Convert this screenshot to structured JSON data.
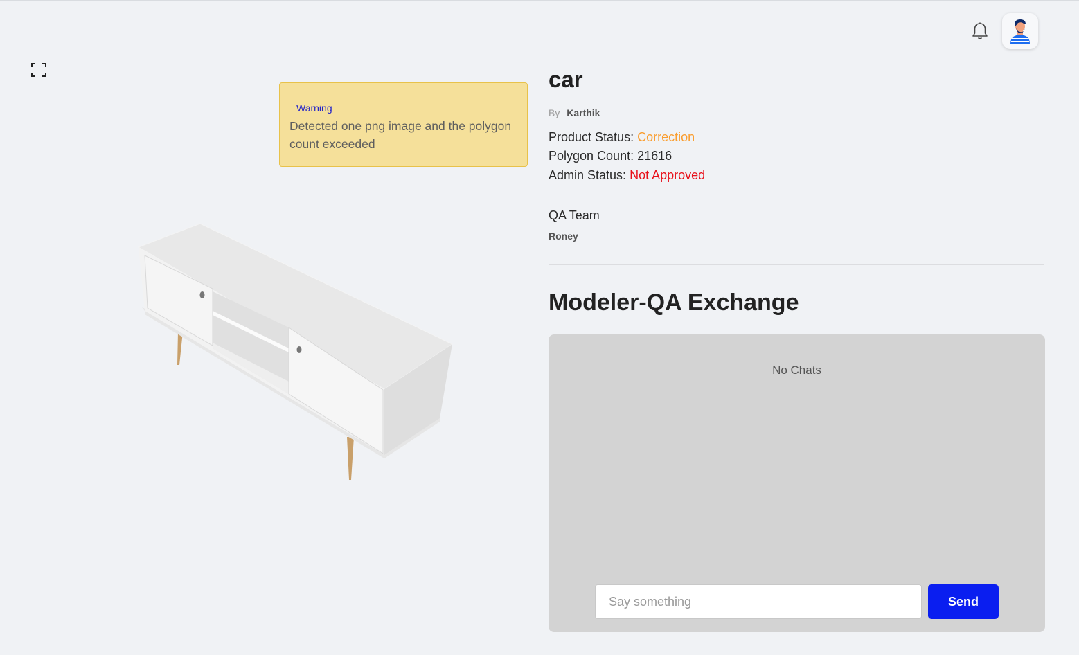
{
  "header": {
    "notification_icon": "bell-icon",
    "avatar_icon": "user-avatar-icon"
  },
  "viewer": {
    "fullscreen_icon": "fullscreen-icon",
    "warning": {
      "title": "Warning",
      "message": "Detected one png image and the polygon count exceeded"
    },
    "model": "tv-cabinet-3d-model"
  },
  "product": {
    "title": "car",
    "by_label": "By",
    "author": "Karthik",
    "status_label": "Product Status:",
    "status_value": "Correction",
    "polygon_label": "Polygon Count:",
    "polygon_value": "21616",
    "admin_label": "Admin Status:",
    "admin_value": "Not Approved",
    "qa_team_label": "QA Team",
    "qa_member": "Roney"
  },
  "exchange": {
    "title": "Modeler-QA Exchange",
    "empty_text": "No Chats",
    "input_placeholder": "Say something",
    "send_label": "Send"
  },
  "colors": {
    "status_correction": "#fa9d2e",
    "status_not_approved": "#e8101a",
    "send_button": "#0a1ef0",
    "warning_bg": "#f5e09a",
    "warning_title": "#2323c8"
  }
}
